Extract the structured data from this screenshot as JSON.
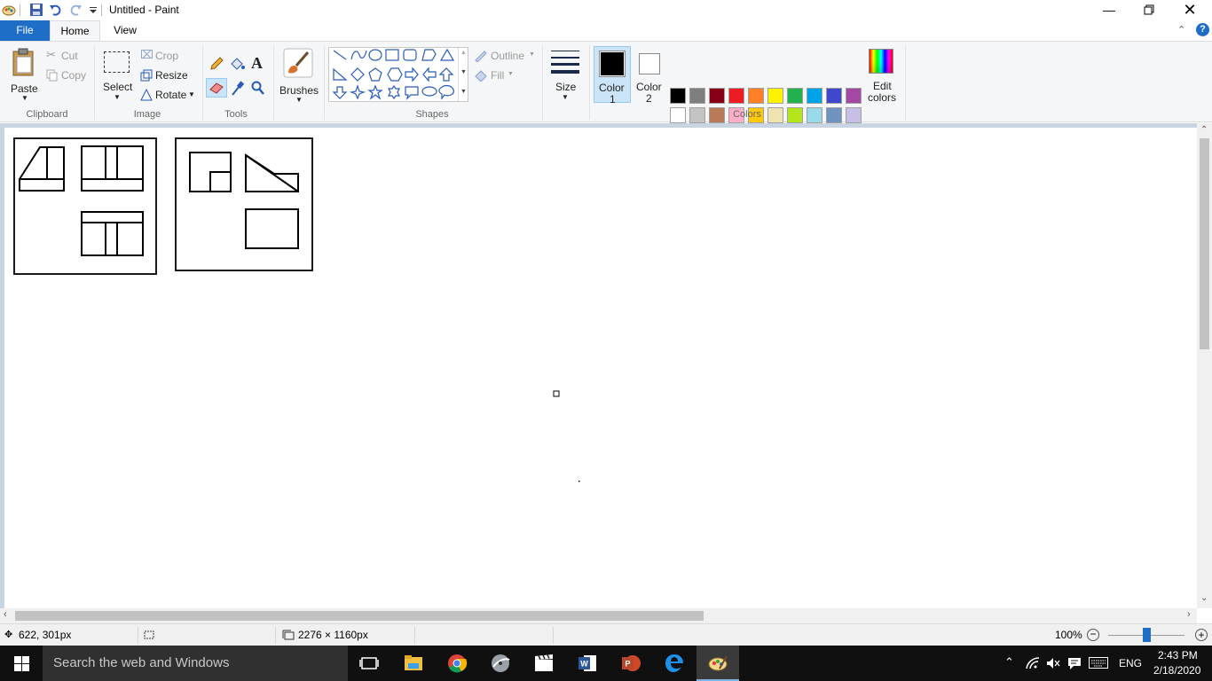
{
  "window": {
    "title": "Untitled - Paint"
  },
  "tabs": {
    "file": "File",
    "home": "Home",
    "view": "View"
  },
  "clipboard": {
    "paste": "Paste",
    "cut": "Cut",
    "copy": "Copy",
    "group": "Clipboard"
  },
  "image": {
    "select": "Select",
    "crop": "Crop",
    "resize": "Resize",
    "rotate": "Rotate",
    "group": "Image"
  },
  "tools": {
    "group": "Tools"
  },
  "brushes": {
    "label": "Brushes"
  },
  "shapes": {
    "outline": "Outline",
    "fill": "Fill",
    "group": "Shapes"
  },
  "size": {
    "label": "Size"
  },
  "colors": {
    "color1_line1": "Color",
    "color1_line2": "1",
    "color2_line1": "Color",
    "color2_line2": "2",
    "edit_line1": "Edit",
    "edit_line2": "colors",
    "group": "Colors",
    "color1": "#000000",
    "color2": "#ffffff",
    "palette_row1": [
      "#000000",
      "#7f7f7f",
      "#880015",
      "#ed1c24",
      "#ff7f27",
      "#fff200",
      "#22b14c",
      "#00a2e8",
      "#3f48cc",
      "#a349a4"
    ],
    "palette_row2": [
      "#ffffff",
      "#c3c3c3",
      "#b97a57",
      "#ffaec9",
      "#ffc90e",
      "#efe4b0",
      "#b5e61d",
      "#99d9ea",
      "#7092be",
      "#c8bfe7"
    ]
  },
  "status": {
    "cursor_pos": "622, 301px",
    "image_size": "2276 × 1160px",
    "zoom": "100%"
  },
  "taskbar": {
    "search_placeholder": "Search the web and Windows",
    "lang": "ENG",
    "time": "2:43 PM",
    "date": "2/18/2020"
  }
}
